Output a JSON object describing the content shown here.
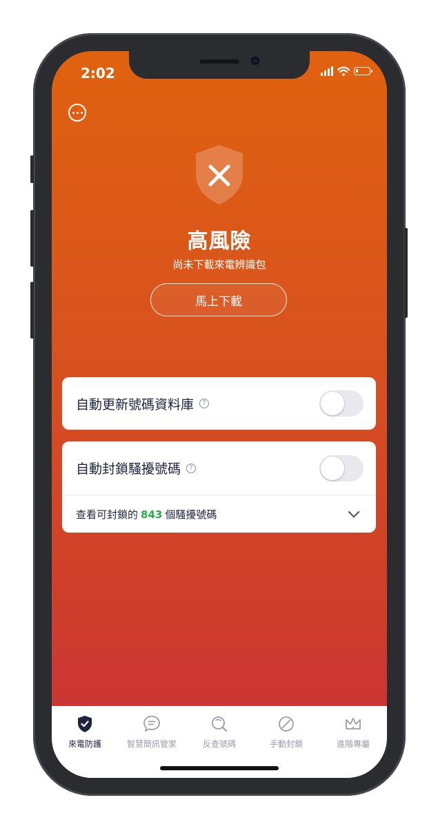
{
  "status_bar": {
    "time": "2:02"
  },
  "hero": {
    "title": "高風險",
    "subtitle": "尚未下載來電辨識包",
    "download_label": "馬上下載"
  },
  "settings": {
    "auto_update": {
      "label": "自動更新號碼資料庫",
      "enabled": false
    },
    "auto_block": {
      "label": "自動封鎖騷擾號碼",
      "enabled": false
    },
    "view_blockable": {
      "prefix": "查看可封鎖的",
      "count": "843",
      "suffix": "個騷擾號碼"
    }
  },
  "tabs": [
    {
      "label": "來電防護",
      "icon": "shield-check-icon",
      "active": true
    },
    {
      "label": "智慧簡訊管家",
      "icon": "message-icon",
      "active": false
    },
    {
      "label": "反查號碼",
      "icon": "search-icon",
      "active": false
    },
    {
      "label": "手動封鎖",
      "icon": "block-icon",
      "active": false
    },
    {
      "label": "進階專屬",
      "icon": "crown-icon",
      "active": false
    }
  ],
  "colors": {
    "accent_green": "#23b04a",
    "gradient_top": "#e0620f",
    "gradient_bottom": "#c8303a",
    "text_dark": "#1e2340"
  }
}
